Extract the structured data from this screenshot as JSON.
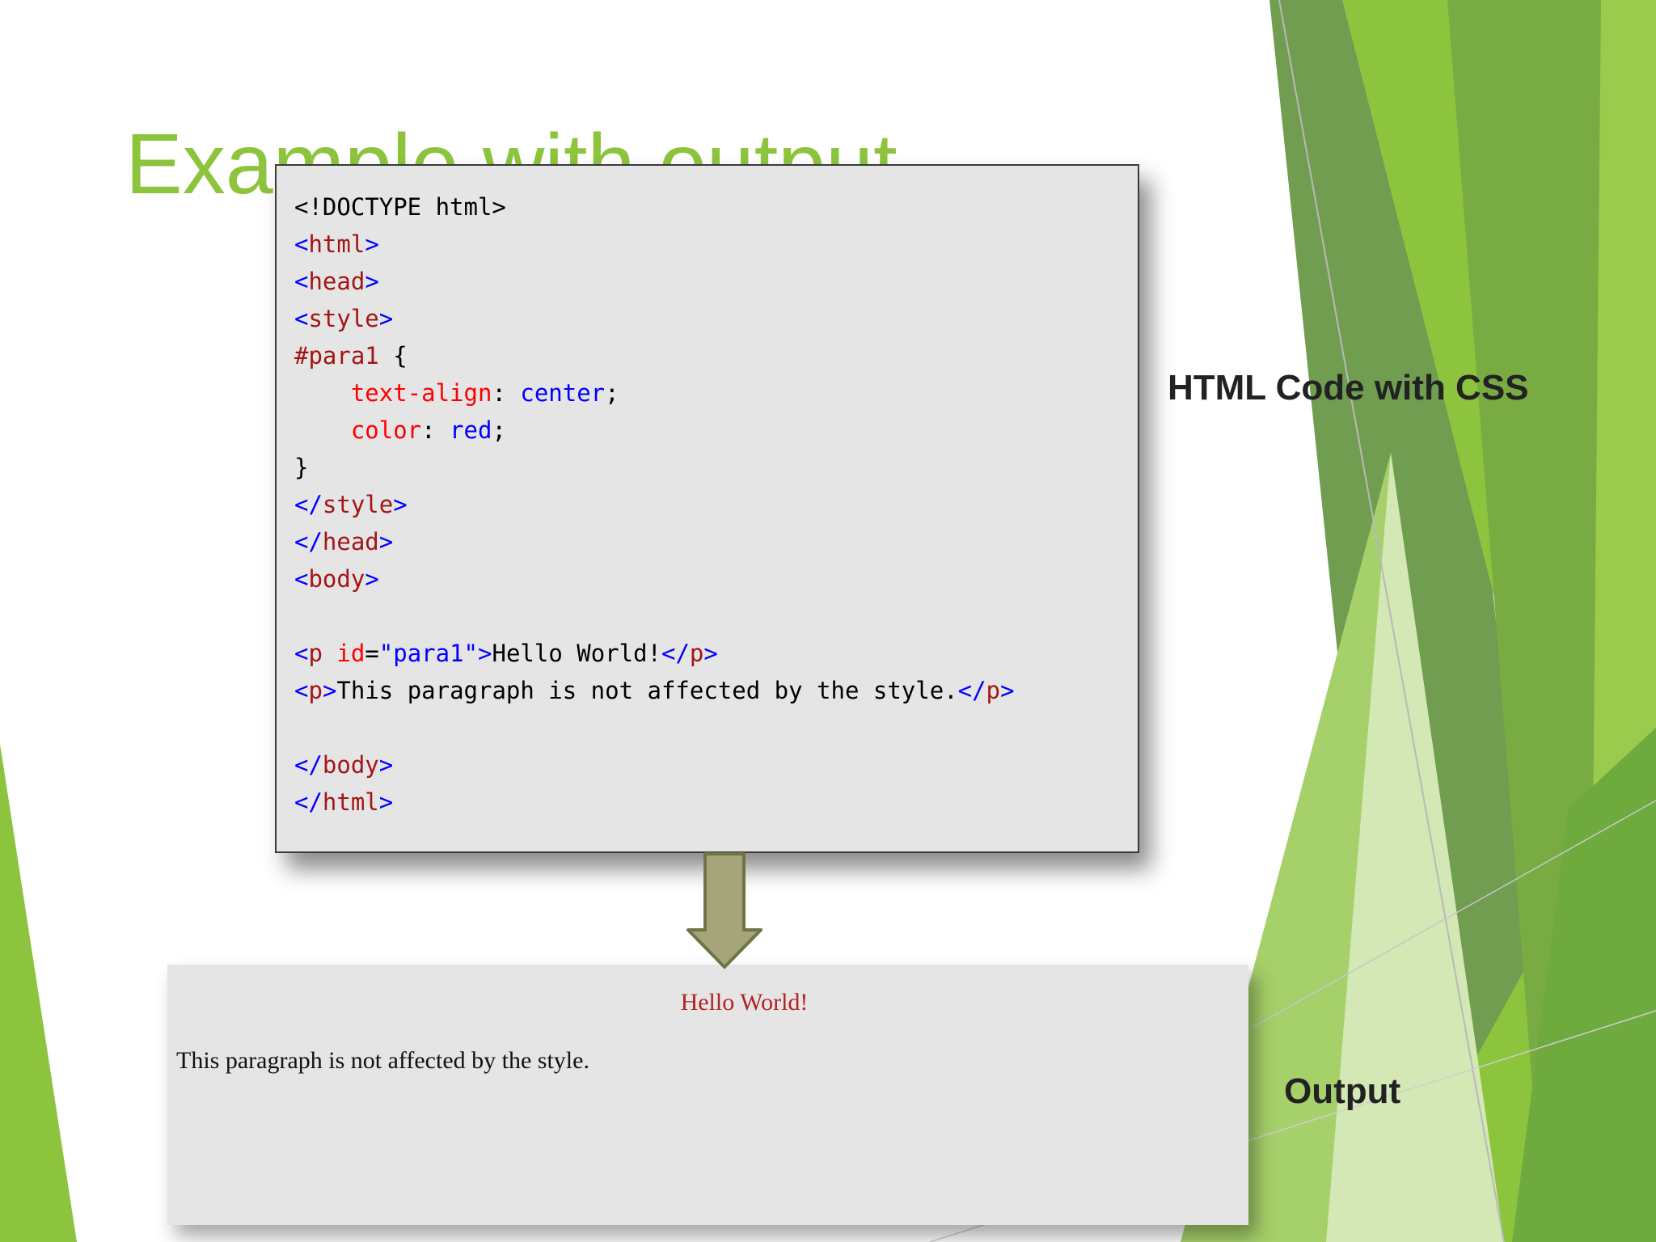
{
  "slide": {
    "title": "Example with output",
    "code_label": "HTML Code with CSS",
    "output_label": "Output"
  },
  "code": {
    "doctype": "<!DOCTYPE html>",
    "l_html_open": {
      "a": "<",
      "b": "html",
      "c": ">"
    },
    "l_head_open": {
      "a": "<",
      "b": "head",
      "c": ">"
    },
    "l_style_open": {
      "a": "<",
      "b": "style",
      "c": ">"
    },
    "l_selector": {
      "a": "#para1",
      "b": " {"
    },
    "l_text_align": {
      "indent": "    ",
      "prop": "text-align",
      "colon": ": ",
      "value": "center",
      "semi": ";"
    },
    "l_color": {
      "indent": "    ",
      "prop": "color",
      "colon": ": ",
      "value": "red",
      "semi": ";"
    },
    "l_close_brace": "}",
    "l_style_close": {
      "a": "</",
      "b": "style",
      "c": ">"
    },
    "l_head_close": {
      "a": "</",
      "b": "head",
      "c": ">"
    },
    "l_body_open": {
      "a": "<",
      "b": "body",
      "c": ">"
    },
    "l_p1": {
      "a": "<",
      "b": "p",
      "c": " ",
      "attr": "id",
      "eq": "=",
      "val": "\"para1\"",
      "d": ">",
      "text": "Hello World!",
      "e": "</",
      "f": "p",
      "g": ">"
    },
    "l_p2": {
      "a": "<",
      "b": "p",
      "c": ">",
      "text": "This paragraph is not affected by the style.",
      "e": "</",
      "f": "p",
      "g": ">"
    },
    "l_body_close": {
      "a": "</",
      "b": "body",
      "c": ">"
    },
    "l_html_close": {
      "a": "</",
      "b": "html",
      "c": ">"
    }
  },
  "output": {
    "p1": "Hello World!",
    "p2": "This paragraph is not affected by the style."
  },
  "colors": {
    "title_green": "#8dc43d",
    "tag": "#a31515",
    "bracket_value": "#0000ff",
    "property": "#ff0000",
    "output_red": "#b22222",
    "arrow_fill": "#a6a57a"
  }
}
